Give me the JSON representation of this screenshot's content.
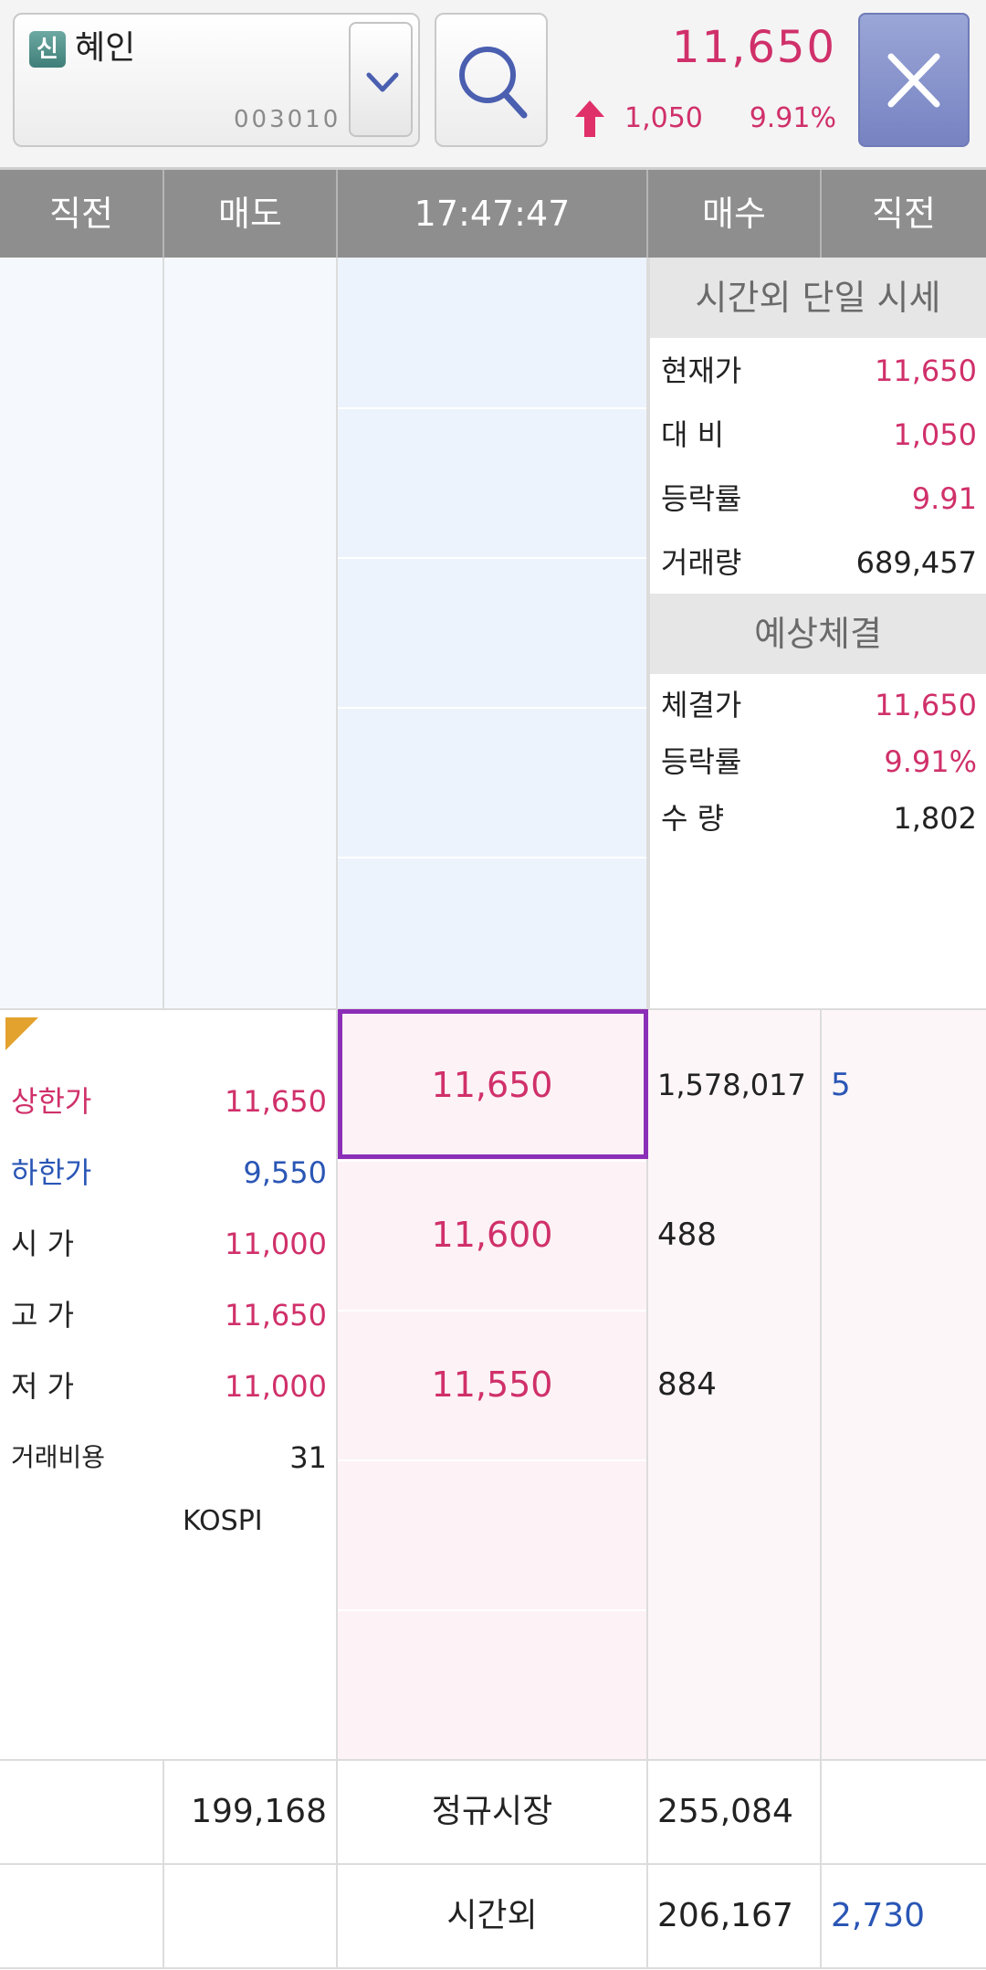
{
  "header": {
    "badge": "신",
    "stock_name": "혜인",
    "stock_code": "003010",
    "price": "11,650",
    "change": "1,050",
    "rate": "9.91%"
  },
  "columns": [
    "직전",
    "매도",
    "17:47:47",
    "매수",
    "직전"
  ],
  "after_hours_panel": {
    "title": "시간외 단일 시세",
    "rows": [
      {
        "label": "현재가",
        "value": "11,650"
      },
      {
        "label": "대 비",
        "value": "1,050"
      },
      {
        "label": "등락률",
        "value": "9.91"
      },
      {
        "label": "거래량",
        "value": "689,457"
      }
    ]
  },
  "expected_panel": {
    "title": "예상체결",
    "rows": [
      {
        "label": "체결가",
        "value": "11,650"
      },
      {
        "label": "등락률",
        "value": "9.91%"
      },
      {
        "label": "수 량",
        "value": "1,802"
      }
    ]
  },
  "stats": [
    {
      "label": "상한가",
      "value": "11,650"
    },
    {
      "label": "하한가",
      "value": "9,550"
    },
    {
      "label": "시 가",
      "value": "11,000"
    },
    {
      "label": "고 가",
      "value": "11,650"
    },
    {
      "label": "저 가",
      "value": "11,000"
    },
    {
      "label": "거래비용",
      "value": "31"
    }
  ],
  "market": "KOSPI",
  "bids": [
    {
      "price": "11,650",
      "qty": "1,578,017",
      "prev": "5"
    },
    {
      "price": "11,600",
      "qty": "488",
      "prev": ""
    },
    {
      "price": "11,550",
      "qty": "884",
      "prev": ""
    }
  ],
  "footer": {
    "regular": {
      "ask_total": "199,168",
      "label": "정규시장",
      "bid_total": "255,084"
    },
    "after": {
      "label": "시간외",
      "bid_total": "206,167",
      "prev": "2,730"
    }
  },
  "colors": {
    "up": "#d0306a",
    "down": "#2a56b5",
    "accent": "#8c2fb8"
  }
}
